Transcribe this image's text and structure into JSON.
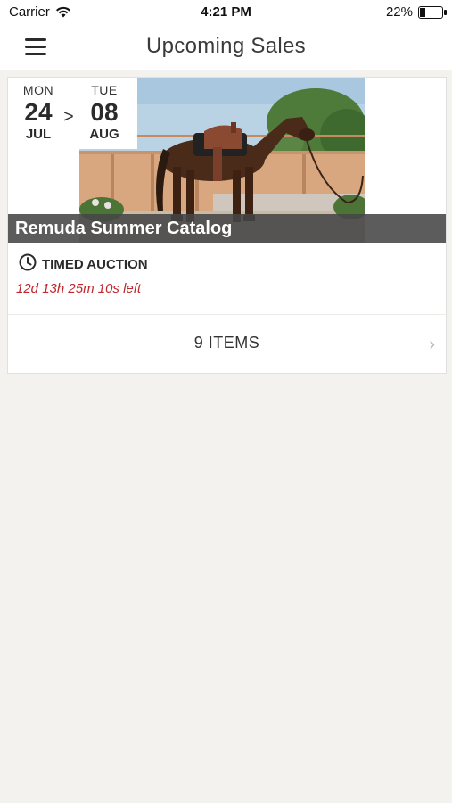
{
  "status_bar": {
    "carrier": "Carrier",
    "time": "4:21 PM",
    "battery": "22%",
    "battery_level": 0.22
  },
  "nav": {
    "title": "Upcoming Sales",
    "menu_icon": "hamburger-menu-icon"
  },
  "sale": {
    "start": {
      "dow": "MON",
      "day": "24",
      "month": "JUL"
    },
    "separator": ">",
    "end": {
      "dow": "TUE",
      "day": "08",
      "month": "AUG"
    },
    "title": "Remuda Summer Catalog",
    "type_label": "TIMED AUCTION",
    "type_icon": "clock-icon",
    "time_left": "12d 13h 25m 10s left",
    "items_label": "9 ITEMS",
    "chevron_icon": "chevron-right-icon"
  },
  "colors": {
    "background": "#f3f2ef",
    "time_left": "#c0272d",
    "title_band": "#464646"
  }
}
